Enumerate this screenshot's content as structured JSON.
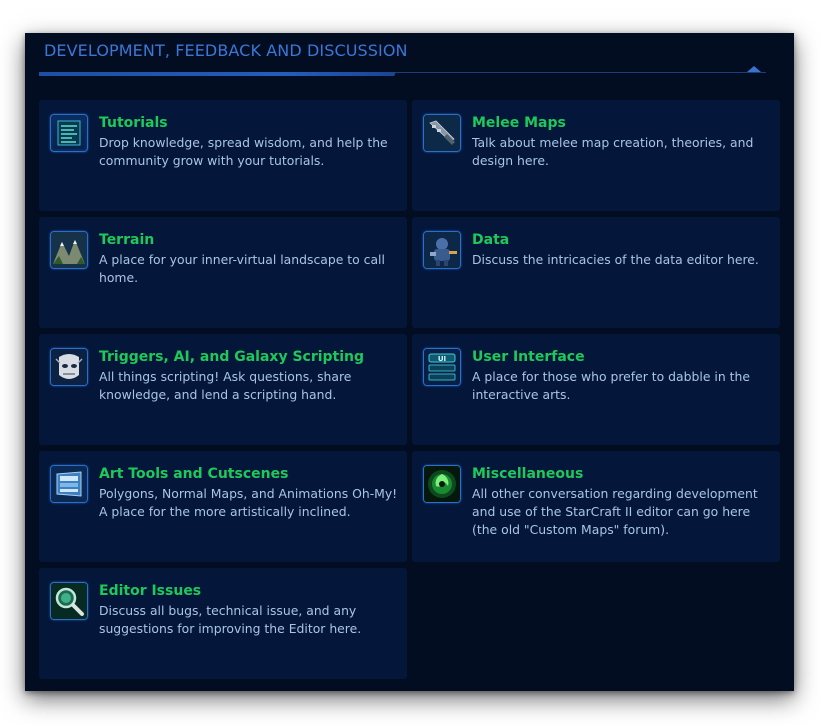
{
  "section": {
    "title": "DEVELOPMENT, FEEDBACK AND DISCUSSION"
  },
  "forums": [
    {
      "title": "Tutorials",
      "description": "Drop knowledge, spread wisdom, and help the community grow with your tutorials.",
      "icon": "tutorials-icon"
    },
    {
      "title": "Melee Maps",
      "description": "Talk about melee map creation, theories, and design here.",
      "icon": "melee-maps-icon"
    },
    {
      "title": "Terrain",
      "description": "A place for your inner-virtual landscape to call home.",
      "icon": "terrain-icon"
    },
    {
      "title": "Data",
      "description": "Discuss the intricacies of the data editor here.",
      "icon": "data-icon"
    },
    {
      "title": "Triggers, AI, and Galaxy Scripting",
      "description": "All things scripting! Ask questions, share knowledge, and lend a scripting hand.",
      "icon": "triggers-icon"
    },
    {
      "title": "User Interface",
      "description": "A place for those who prefer to dabble in the interactive arts.",
      "icon": "user-interface-icon",
      "icon_text": "UI"
    },
    {
      "title": "Art Tools and Cutscenes",
      "description": "Polygons, Normal Maps, and Animations Oh-My! A place for the more artistically inclined.",
      "icon": "art-tools-icon"
    },
    {
      "title": "Miscellaneous",
      "description": "All other conversation regarding development and use of the StarCraft II editor can go here (the old \"Custom Maps\" forum).",
      "icon": "miscellaneous-icon"
    },
    {
      "title": "Editor Issues",
      "description": "Discuss all bugs, technical issue, and any suggestions for improving the Editor here.",
      "icon": "editor-issues-icon"
    }
  ],
  "colors": {
    "panel_bg": "#020d21",
    "card_bg": "#04173a",
    "title_green": "#1ec95a",
    "header_blue": "#3a77d6",
    "desc_text": "#a9c4e8"
  }
}
